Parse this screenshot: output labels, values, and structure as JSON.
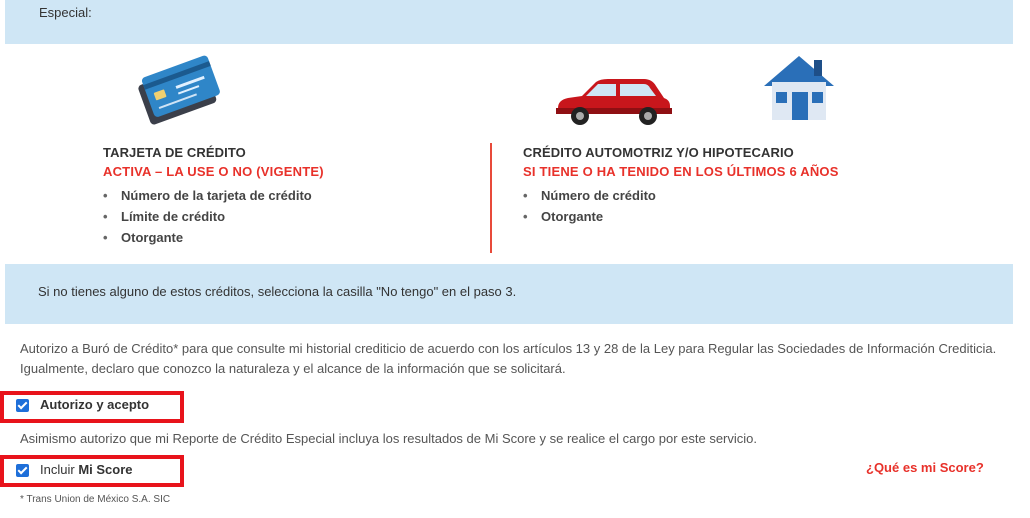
{
  "top_banner": {
    "text": "Especial:"
  },
  "card_section": {
    "title": "TARJETA DE CRÉDITO",
    "subtitle": "ACTIVA – LA USE O NO (VIGENTE)",
    "items": [
      "Número de la tarjeta de crédito",
      "Límite de crédito",
      "Otorgante"
    ],
    "icon": "credit-card-icon"
  },
  "auto_section": {
    "title": "CRÉDITO AUTOMOTRIZ Y/O HIPOTECARIO",
    "subtitle": "SI TIENE O HA TENIDO EN LOS ÚLTIMOS 6 AÑOS",
    "items": [
      "Número de crédito",
      "Otorgante"
    ],
    "icons": [
      "car-icon",
      "house-icon"
    ]
  },
  "info_banner": {
    "text": "Si no tienes alguno de estos créditos, selecciona la casilla \"No tengo\" en el paso 3."
  },
  "authorization": {
    "text": "Autorizo a Buró de Crédito* para que consulte mi historial crediticio de acuerdo con los artículos 13 y 28 de la Ley para Regular las Sociedades de Información Crediticia. Igualmente, declaro que conozco la naturaleza y el alcance de la información que se solicitará.",
    "checkbox_label": "Autorizo y acepto",
    "checked": true
  },
  "score": {
    "text": "Asimismo autorizo que mi Reporte de Crédito Especial incluya los resultados de Mi Score y se realice el cargo por este servicio.",
    "checkbox_prefix": "Incluir",
    "checkbox_bold": "Mi Score",
    "checked": true,
    "link": "¿Qué es mi Score?"
  },
  "footnote": "* Trans Union de México S.A. SIC",
  "colors": {
    "accent_red": "#e8312a",
    "banner_blue": "#cfe6f5",
    "checkbox_blue": "#1e6fd9",
    "highlight_red": "#e8131b"
  }
}
